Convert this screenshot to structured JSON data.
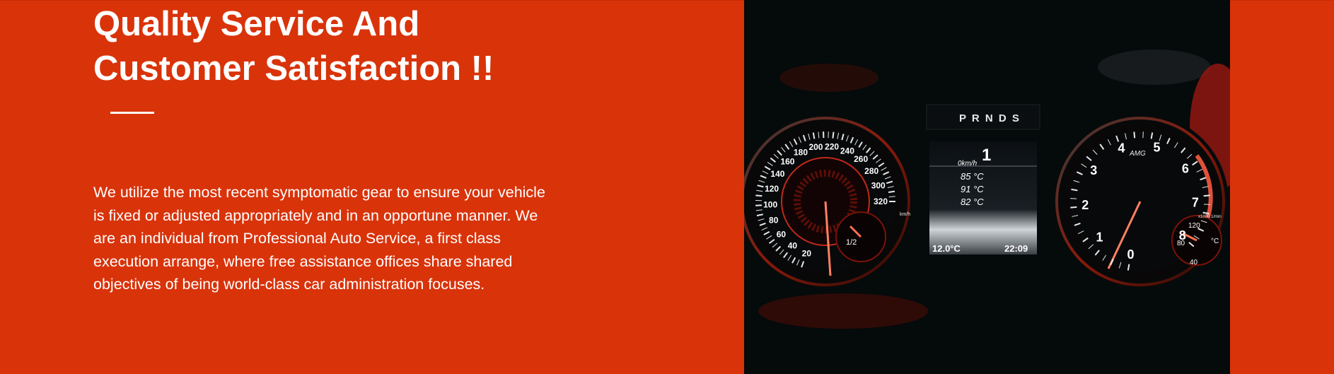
{
  "hero": {
    "title_line1": "Quality Service And",
    "title_line2": "Customer Satisfaction !!",
    "description": "We utilize the most recent symptomatic gear to ensure your vehicle is fixed or adjusted appropriately and in an opportune manner. We are an individual from Professional Auto Service, a first class execution arrange, where free assistance offices share shared objectives of being world-class car administration focuses."
  },
  "dashboard_image": {
    "gear_display": "P R N D S",
    "speed_value": "1",
    "speed_unit": "0km/h",
    "temp1": "85 °C",
    "temp2": "91 °C",
    "temp3": "82 °C",
    "outside_temp": "12.0°C",
    "clock": "22:09",
    "brand": "AMG",
    "speedometer_labels": [
      "20",
      "40",
      "60",
      "80",
      "100",
      "120",
      "140",
      "160",
      "180",
      "200",
      "220",
      "240",
      "260",
      "280",
      "300",
      "320"
    ],
    "tachometer_labels": [
      "0",
      "1",
      "2",
      "3",
      "4",
      "5",
      "6",
      "7",
      "8"
    ],
    "speed_unit_small": "km/h",
    "rpm_unit": "x1000 1/min",
    "fuel_half": "1/2",
    "gauge_120": "120",
    "gauge_80": "80",
    "gauge_40": "40",
    "gauge_c": "°C"
  },
  "colors": {
    "background": "#d9330a",
    "text": "#ffffff",
    "image_bg": "#050a0b"
  }
}
